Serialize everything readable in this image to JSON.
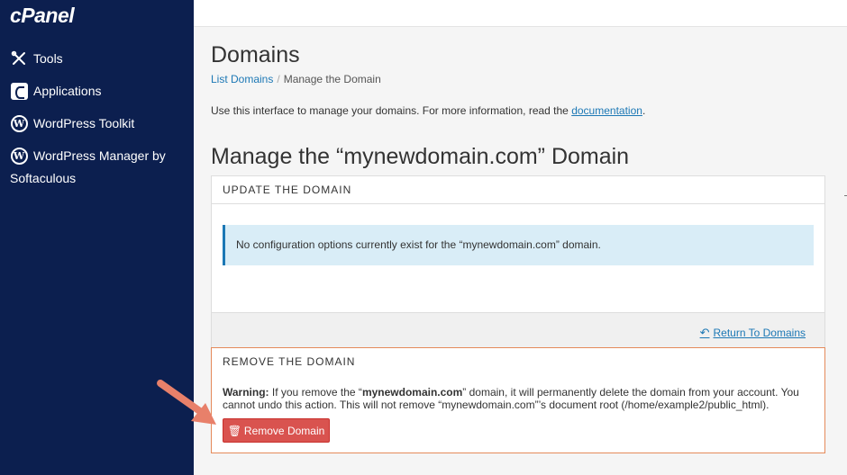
{
  "sidebar": {
    "logo": "cPanel",
    "items": [
      {
        "label": "Tools",
        "icon": "tools-icon"
      },
      {
        "label": "Applications",
        "icon": "applications-icon"
      },
      {
        "label": "WordPress Toolkit",
        "icon": "wordpress-icon"
      },
      {
        "label": "WordPress Manager by",
        "label2": "Softaculous",
        "icon": "wordpress-icon"
      }
    ]
  },
  "header": {
    "title": "Domains",
    "breadcrumb": {
      "link": "List Domains",
      "separator": "/",
      "current": "Manage the Domain"
    },
    "intro_prefix": "Use this interface to manage your domains. For more information, read the ",
    "intro_link": "documentation",
    "intro_suffix": "."
  },
  "section": {
    "title": "Manage the “mynewdomain.com” Domain"
  },
  "update_panel": {
    "heading": "UPDATE THE DOMAIN",
    "info": "No configuration options currently exist for the “mynewdomain.com” domain.",
    "return_link": "Return To Domains"
  },
  "remove_panel": {
    "heading": "REMOVE THE DOMAIN",
    "warning_label": "Warning:",
    "warning_part1": " If you remove the “",
    "domain": "mynewdomain.com",
    "warning_part2": "” domain, it will permanently delete the domain from your account. You cannot undo this action. This will not remove “mynewdomain.com”’s document root (/home/example2/public_html).",
    "button_label": "Remove Domain"
  },
  "colors": {
    "sidebar_bg": "#0c1f4f",
    "link": "#1c78b5",
    "danger": "#d9534f",
    "info_bg": "#d9edf7",
    "remove_border": "#e58a5a",
    "arrow": "#e8806a"
  }
}
